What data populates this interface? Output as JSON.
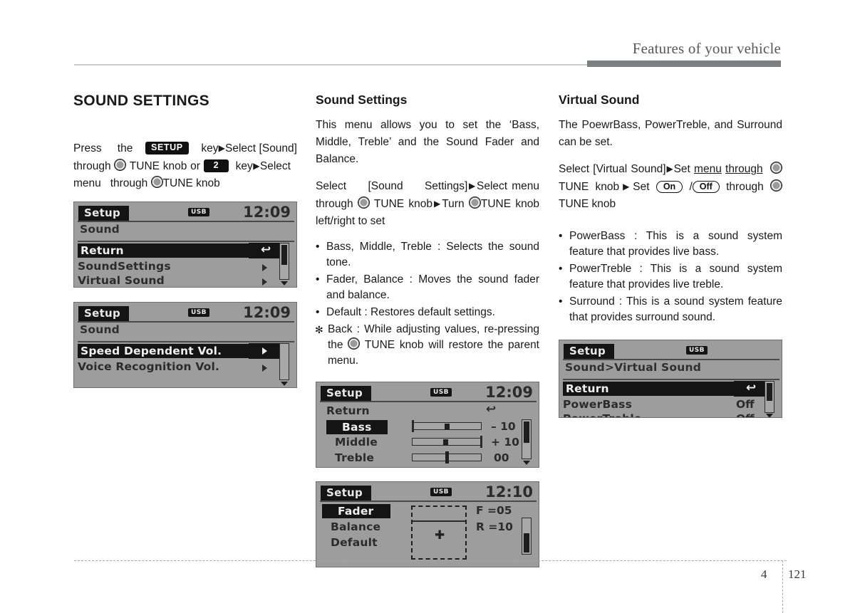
{
  "header": {
    "title": "Features of your vehicle"
  },
  "footer": {
    "chapter": "4",
    "page": "121"
  },
  "left": {
    "section_title": "SOUND SETTINGS",
    "steps": {
      "t1": "Press",
      "t2": "the",
      "setup_key": "SETUP",
      "t3": "key",
      "t4": "Select",
      "t5": "[Sound] through",
      "t6": "TUNE knob or",
      "num_key": "2",
      "t7": "key",
      "t8": "Select",
      "t9": "menu",
      "t10": "through",
      "t11": "TUNE knob"
    },
    "lcd1": {
      "title": "Setup",
      "usb": "USB",
      "clock": "12:09",
      "breadcrumb": "Sound",
      "rows": [
        {
          "label": "Return",
          "value": "",
          "selected": true,
          "icon": "return-arrow"
        },
        {
          "label": "SoundSettings",
          "value": "",
          "selected": false,
          "icon": "caret"
        },
        {
          "label": "Virtual Sound",
          "value": "",
          "selected": false,
          "icon": "caret"
        }
      ]
    },
    "lcd2": {
      "title": "Setup",
      "usb": "USB",
      "clock": "12:09",
      "breadcrumb": "Sound",
      "rows": [
        {
          "label": "Speed Dependent Vol.",
          "value": "",
          "selected": true,
          "icon": "caret"
        },
        {
          "label": "Voice Recognition Vol.",
          "value": "",
          "selected": false,
          "icon": "caret"
        }
      ]
    }
  },
  "middle": {
    "sub_title": "Sound Settings",
    "para1": "This menu allows you to set the ‘Bass, Middle, Treble’ and the Sound Fader and Balance.",
    "steps": {
      "s1": "Select",
      "s2": "[Sound",
      "s3": "Settings]",
      "s4": "Select",
      "s5": "menu through",
      "s6": "TUNE knob",
      "s7": "Turn",
      "s8": "TUNE knob left/right to set"
    },
    "bullets": [
      {
        "marker": "•",
        "text": "Bass, Middle, Treble : Selects the sound tone."
      },
      {
        "marker": "•",
        "text": "Fader, Balance : Moves the sound fader and balance."
      },
      {
        "marker": "•",
        "text": "Default : Restores default settings."
      }
    ],
    "note": {
      "marker": "✻",
      "pre": "Back : While adjusting values, re-pressing the",
      "post": "TUNE knob will restore the parent menu."
    },
    "lcd3": {
      "title": "Setup",
      "usb": "USB",
      "clock": "12:09",
      "rows": [
        {
          "label": "Return",
          "value": "",
          "selected": false,
          "icon": "return-arrow"
        },
        {
          "label": "Bass",
          "value": "– 10",
          "selected": true,
          "icon": "slider"
        },
        {
          "label": "Middle",
          "value": "+ 10",
          "selected": false,
          "icon": "slider"
        },
        {
          "label": "Treble",
          "value": "00",
          "selected": false,
          "icon": "slider"
        }
      ]
    },
    "lcd4": {
      "title": "Setup",
      "usb": "USB",
      "clock": "12:10",
      "rows": [
        {
          "label": "Fader",
          "value": "F =05",
          "selected": true
        },
        {
          "label": "Balance",
          "value": "R =10",
          "selected": false
        },
        {
          "label": "Default",
          "value": "",
          "selected": false
        }
      ]
    }
  },
  "right": {
    "sub_title": "Virtual Sound",
    "para1": "The PoewrBass, PowerTreble, and Surround can be set.",
    "steps": {
      "r1": "Select [Virtual Sound]",
      "r2": "Set",
      "r3": "menu",
      "r4": "through",
      "r5": "TUNE knob",
      "r6": "Set",
      "on_label": "On",
      "slash": "/",
      "off_label": "Off",
      "r7": "through",
      "r8": "TUNE knob"
    },
    "bullets": [
      {
        "marker": "•",
        "text": "PowerBass : This is a sound system feature that provides live bass."
      },
      {
        "marker": "•",
        "text": "PowerTreble : This is a sound system feature that provides live treble."
      },
      {
        "marker": "•",
        "text": "Surround : This is a sound system feature that provides surround sound."
      }
    ],
    "lcd5": {
      "title": "Setup",
      "usb": "USB",
      "clock": "",
      "breadcrumb": "Sound>Virtual Sound",
      "rows": [
        {
          "label": "Return",
          "value": "",
          "selected": true,
          "icon": "return-arrow"
        },
        {
          "label": "PowerBass",
          "value": "Off",
          "selected": false
        },
        {
          "label": "PowerTreble",
          "value": "Off",
          "selected": false
        }
      ]
    }
  }
}
